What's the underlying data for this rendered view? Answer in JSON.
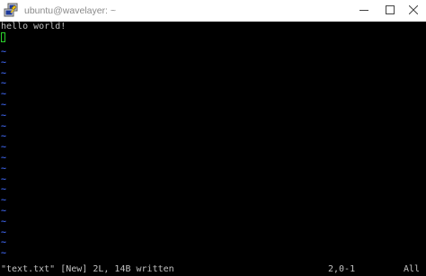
{
  "window": {
    "title": "ubuntu@wavelayer: ~",
    "app_icon": "putty-icon",
    "controls": {
      "minimize": "minimize-icon",
      "maximize": "maximize-icon",
      "close": "close-icon"
    }
  },
  "editor": {
    "lines": [
      "hello world!",
      ""
    ],
    "empty_line_marker": "~",
    "empty_line_count": 20
  },
  "statusline": {
    "message": "\"text.txt\" [New] 2L, 14B written",
    "position": "2,0-1",
    "scroll": "All"
  },
  "colors": {
    "background": "#000000",
    "text": "#c0c0c0",
    "tilde": "#3b5fe0",
    "cursor": "#2bd12b",
    "titlebar": "#ffffff"
  }
}
